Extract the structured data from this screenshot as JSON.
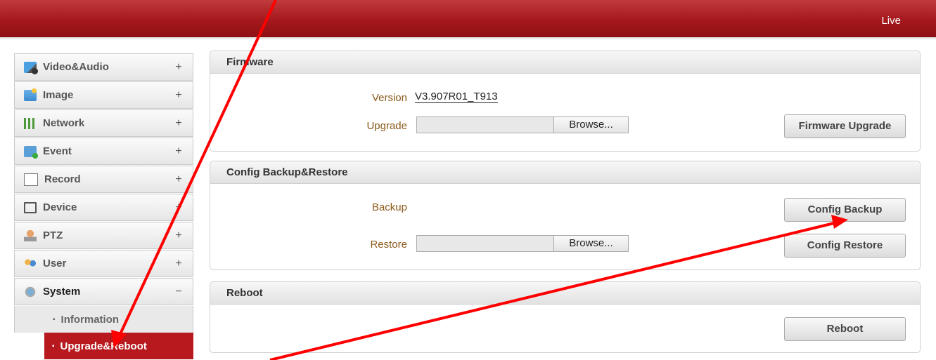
{
  "header": {
    "live_label": "Live"
  },
  "sidebar": {
    "items": [
      {
        "label": "Video&Audio",
        "icon": "video-audio-icon",
        "toggle": "+"
      },
      {
        "label": "Image",
        "icon": "image-icon",
        "toggle": "+"
      },
      {
        "label": "Network",
        "icon": "network-icon",
        "toggle": "+"
      },
      {
        "label": "Event",
        "icon": "event-icon",
        "toggle": "+"
      },
      {
        "label": "Record",
        "icon": "record-icon",
        "toggle": "+"
      },
      {
        "label": "Device",
        "icon": "device-icon",
        "toggle": "+"
      },
      {
        "label": "PTZ",
        "icon": "ptz-icon",
        "toggle": "+"
      },
      {
        "label": "User",
        "icon": "user-icon",
        "toggle": "+"
      },
      {
        "label": "System",
        "icon": "system-icon",
        "toggle": "−"
      }
    ],
    "subitems": [
      {
        "label": "Information"
      },
      {
        "label": "Upgrade&Reboot"
      }
    ]
  },
  "firmware": {
    "title": "Firmware",
    "version_label": "Version",
    "version_value": "V3.907R01_T913",
    "upgrade_label": "Upgrade",
    "browse_label": "Browse...",
    "upgrade_button": "Firmware Upgrade"
  },
  "config": {
    "title": "Config Backup&Restore",
    "backup_label": "Backup",
    "restore_label": "Restore",
    "browse_label": "Browse...",
    "backup_button": "Config Backup",
    "restore_button": "Config Restore"
  },
  "reboot": {
    "title": "Reboot",
    "reboot_button": "Reboot"
  },
  "colors": {
    "brand_red": "#a4181c",
    "annotation_red": "#ff0000",
    "label_brown": "#8b5a1a"
  }
}
